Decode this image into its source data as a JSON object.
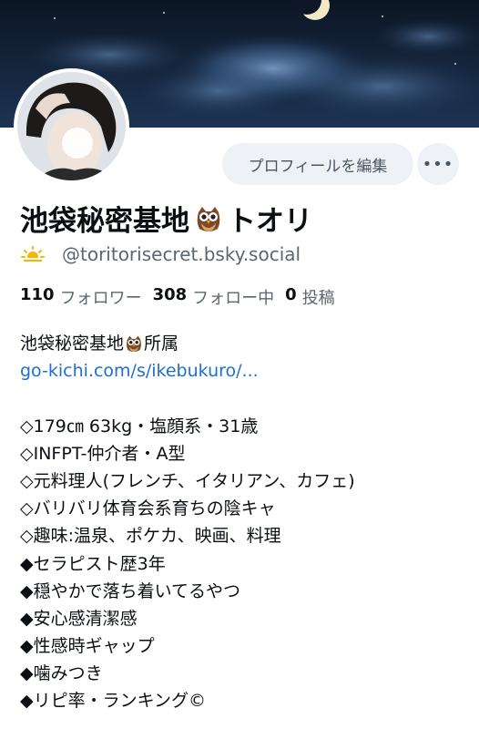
{
  "profile": {
    "name_part1": "池袋秘密基地",
    "name_part2": "トオリ",
    "handle": "@toritorisecret.bsky.social",
    "edit_label": "プロフィールを編集",
    "more_label": "•••"
  },
  "stats": {
    "followers_count": "110",
    "followers_label": "フォロワー",
    "following_count": "308",
    "following_label": "フォロー中",
    "posts_count": "0",
    "posts_label": "投稿"
  },
  "bio": {
    "line1_a": "池袋秘密基地",
    "line1_b": "所属",
    "link": "go-kichi.com/s/ikebukuro/...",
    "lines": [
      "◇179㎝ 63kg・塩顔系・31歳",
      "◇INFPT-仲介者・A型",
      "◇元料理人(フレンチ、イタリアン、カフェ)",
      "◇バリバリ体育会系育ちの陰キャ",
      "◇趣味:温泉、ポケカ、映画、料理",
      "◆セラピスト歴3年",
      "◆穏やかで落ち着いてるやつ",
      "◆安心感清潔感",
      "◆性感時ギャップ",
      "◆噛みつき",
      "◆リピ率・ランキング©"
    ]
  },
  "icons": {
    "owl": "owl-emoji",
    "sun": "sun-emoji",
    "more": "ellipsis-icon"
  },
  "colors": {
    "link": "#1f6fd1",
    "muted": "#5b6671",
    "button_bg": "#eef2f6"
  }
}
